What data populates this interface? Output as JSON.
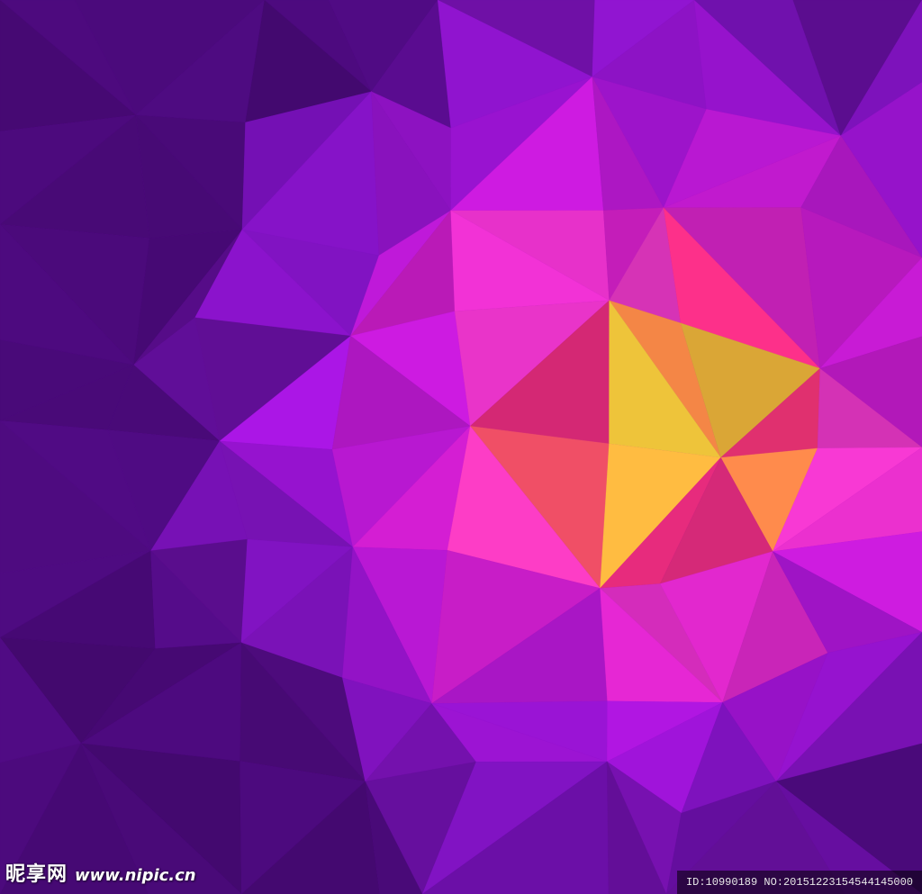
{
  "background": {
    "style": "low-poly triangles",
    "colors": {
      "deep_violet": "#4a0a7a",
      "violet": "#7a12b8",
      "purple": "#a414d8",
      "magenta": "#d21ec8",
      "pink": "#ec3cc4",
      "rose": "#e82a78",
      "orange": "#ee8c3e",
      "amber": "#eebc3a",
      "yellow": "#f0d83a"
    }
  },
  "watermark": {
    "logo_text": "昵享网",
    "site_url": "www.nipic.cn",
    "id_text": "ID:10990189 NO:20151223154544145000"
  }
}
